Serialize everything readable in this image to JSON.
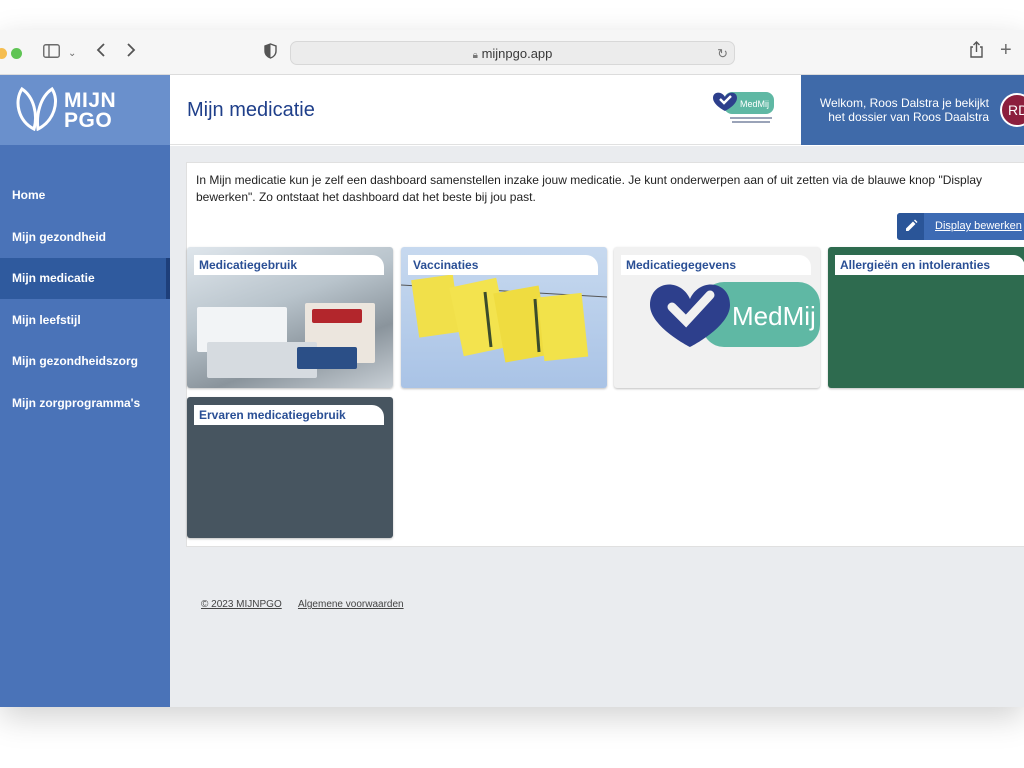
{
  "browser": {
    "url": "mijnpgo.app"
  },
  "app": {
    "logo_text_line1": "MIJN",
    "logo_text_line2": "PGO",
    "page_title": "Mijn medicatie",
    "welcome_text": "Welkom, Roos Dalstra je bekijkt het dossier van Roos Daalstra",
    "avatar_initials": "RD"
  },
  "sidebar": {
    "items": [
      {
        "label": "Home"
      },
      {
        "label": "Mijn gezondheid"
      },
      {
        "label": "Mijn medicatie",
        "active": true
      },
      {
        "label": "Mijn leefstijl"
      },
      {
        "label": "Mijn gezondheidszorg"
      },
      {
        "label": "Mijn zorgprogramma's"
      }
    ]
  },
  "main": {
    "intro": "In Mijn medicatie kun je zelf een dashboard samenstellen inzake jouw medicatie. Je kunt onderwerpen aan of uit zetten via de blauwe knop \"Display bewerken\". Zo ontstaat het dashboard dat het beste bij jou past.",
    "edit_button": "Display bewerken",
    "tiles": [
      {
        "label": "Medicatiegebruik"
      },
      {
        "label": "Vaccinaties"
      },
      {
        "label": "Medicatiegegevens"
      },
      {
        "label": "Allergieën en intoleranties"
      },
      {
        "label": "Ervaren medicatiegebruik"
      }
    ],
    "medmij_text": "MedMij"
  },
  "footer": {
    "copyright": "© 2023 MIJNPGO",
    "terms": "Algemene voorwaarden"
  },
  "colors": {
    "sidebar": "#4a73b8",
    "sidebar_active": "#2f5a9e",
    "title": "#1f3f8a",
    "allergy_tile": "#2e6b4f",
    "experience_tile": "#475560"
  }
}
